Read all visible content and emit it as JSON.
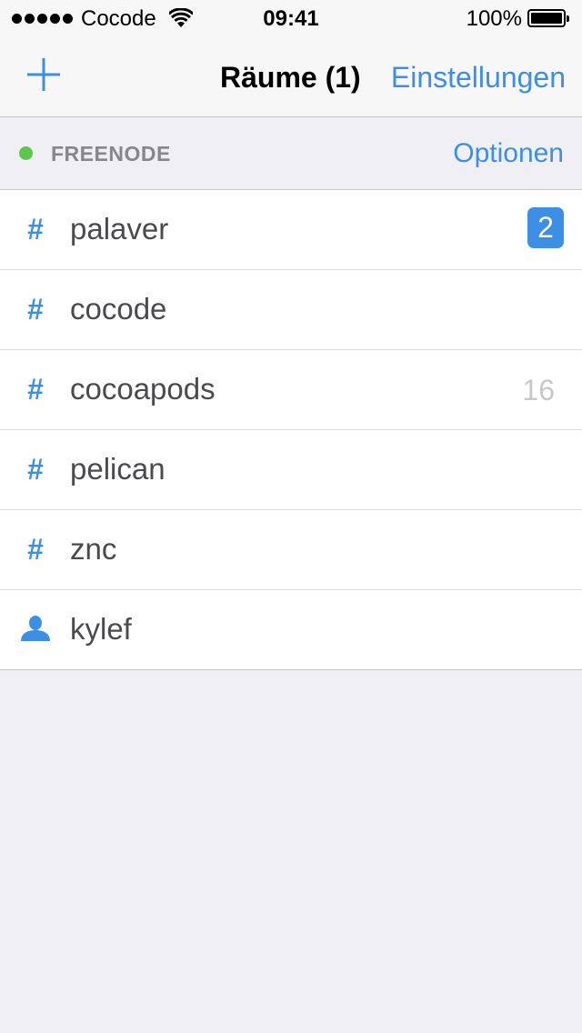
{
  "status_bar": {
    "carrier": "Cocode",
    "time": "09:41",
    "battery": "100%",
    "signal_bars": 5,
    "wifi_icon": "wifi-icon",
    "battery_icon": "battery-icon"
  },
  "nav": {
    "add_icon": "plus-icon",
    "title": "Räume (1)",
    "settings_label": "Einstellungen"
  },
  "section": {
    "server_name": "FREENODE",
    "status_color": "#5cc84b",
    "options_label": "Optionen"
  },
  "rooms": [
    {
      "icon": "hash-icon",
      "symbol": "#",
      "name": "palaver",
      "badge": "2",
      "badge_style": "highlight"
    },
    {
      "icon": "hash-icon",
      "symbol": "#",
      "name": "cocode",
      "badge": "",
      "badge_style": "none"
    },
    {
      "icon": "hash-icon",
      "symbol": "#",
      "name": "cocoapods",
      "badge": "16",
      "badge_style": "plain"
    },
    {
      "icon": "hash-icon",
      "symbol": "#",
      "name": "pelican",
      "badge": "",
      "badge_style": "none"
    },
    {
      "icon": "hash-icon",
      "symbol": "#",
      "name": "znc",
      "badge": "",
      "badge_style": "none"
    },
    {
      "icon": "person-icon",
      "symbol": "",
      "name": "kylef",
      "badge": "",
      "badge_style": "none"
    }
  ],
  "colors": {
    "accent": "#3d8fe6",
    "background": "#efeff4",
    "online": "#5cc84b"
  }
}
